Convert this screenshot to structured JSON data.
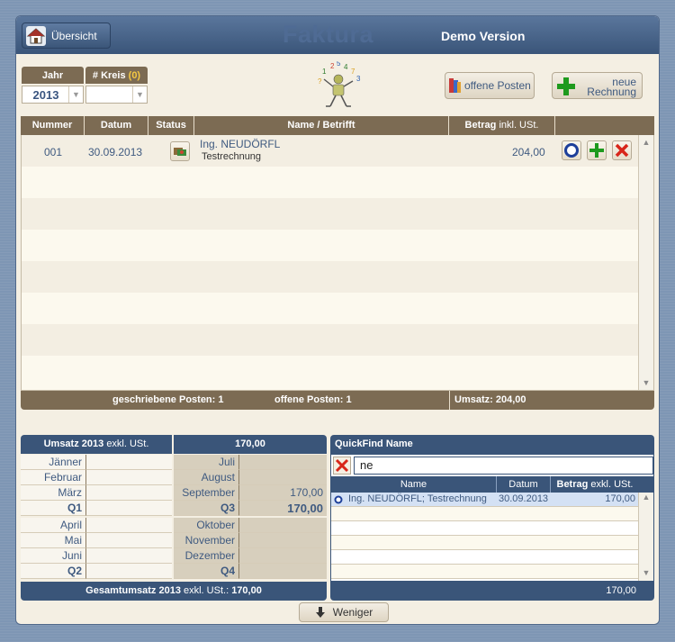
{
  "header": {
    "overview_button": "Übersicht",
    "app_title": "Faktura",
    "edition": "Demo Version"
  },
  "filters": {
    "jahr_label": "Jahr",
    "kreis_label": "# Kreis",
    "kreis_count": "(0)",
    "jahr_value": "2013",
    "kreis_value": ""
  },
  "actions": {
    "offene_posten": "offene Posten",
    "neue_rechnung_line1": "neue",
    "neue_rechnung_line2": "Rechnung"
  },
  "table": {
    "columns": {
      "nummer": "Nummer",
      "datum": "Datum",
      "status": "Status",
      "name": "Name / Betrifft",
      "betrag": "Betrag",
      "betrag_suffix": "inkl. USt."
    },
    "rows": [
      {
        "nummer": "001",
        "datum": "30.09.2013",
        "name": "Ing. NEUDÖRFL",
        "betrifft": "Testrechnung",
        "betrag": "204,00"
      }
    ],
    "footer": {
      "geschriebene": "geschriebene Posten: 1",
      "offene": "offene Posten: 1",
      "umsatz": "Umsatz: 204,00"
    }
  },
  "umsatz": {
    "title": "Umsatz 2013",
    "title_suffix": "exkl. USt.",
    "total": "170,00",
    "months_left": [
      "Jänner",
      "Februar",
      "März"
    ],
    "q1": "Q1",
    "months_left2": [
      "April",
      "Mai",
      "Juni"
    ],
    "q2": "Q2",
    "months_right": [
      "Juli",
      "August",
      "September"
    ],
    "september_value": "170,00",
    "q3": "Q3",
    "q3_value": "170,00",
    "months_right2": [
      "Oktober",
      "November",
      "Dezember"
    ],
    "q4": "Q4",
    "footer_label": "Gesamtumsatz 2013",
    "footer_suffix": "exkl. USt.:",
    "footer_value": "170,00"
  },
  "quickfind": {
    "title": "QuickFind Name",
    "search_value": "ne",
    "col_name": "Name",
    "col_datum": "Datum",
    "col_betrag": "Betrag",
    "col_betrag_suffix": "exkl. USt.",
    "results": [
      {
        "name": "Ing. NEUDÖRFL; Testrechnung",
        "datum": "30.09.2013",
        "betrag": "170,00"
      }
    ],
    "footer_total": "170,00"
  },
  "bottom": {
    "weniger": "Weniger"
  }
}
